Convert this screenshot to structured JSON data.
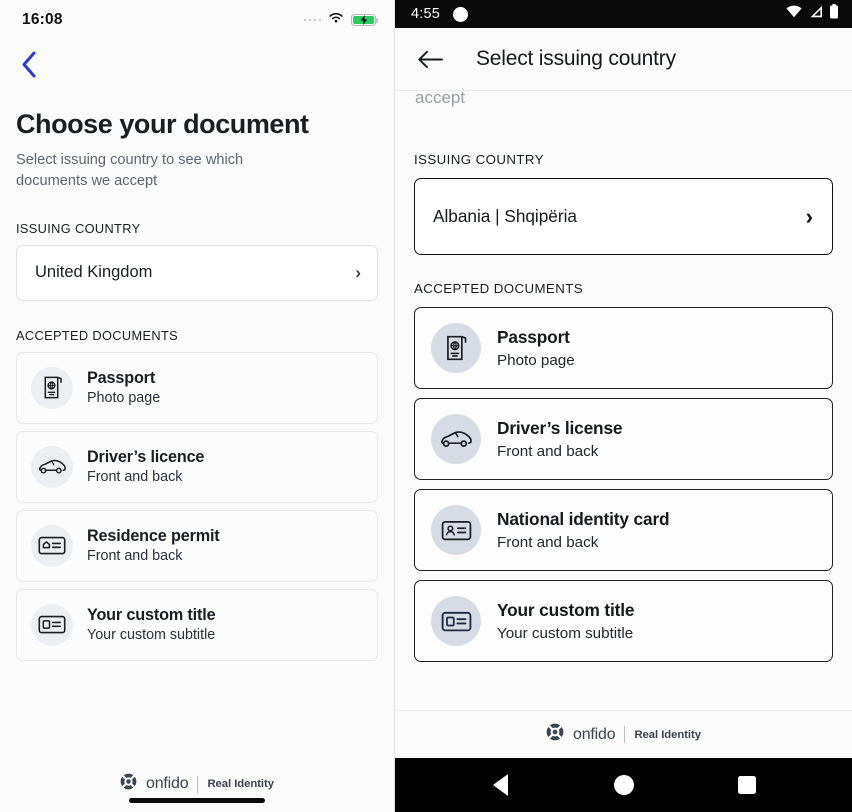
{
  "ios": {
    "status_bar": {
      "time": "16:08",
      "wifi_icon": "wifi-icon",
      "battery_icon": "battery-charging-icon",
      "signal_icon": "signal-dots-icon"
    },
    "back_icon": "chevron-left-icon",
    "heading": "Choose your document",
    "subheading": "Select issuing country to see which documents we accept",
    "issuing_country_label": "ISSUING COUNTRY",
    "selected_country": "United Kingdom",
    "country_chevron": "chevron-right-icon",
    "accepted_documents_label": "ACCEPTED DOCUMENTS",
    "documents": [
      {
        "title": "Passport",
        "subtitle": "Photo page",
        "icon": "passport-icon"
      },
      {
        "title": "Driver’s licence",
        "subtitle": "Front and back",
        "icon": "car-icon"
      },
      {
        "title": "Residence permit",
        "subtitle": "Front and back",
        "icon": "residence-permit-icon"
      },
      {
        "title": "Your custom title",
        "subtitle": "Your custom subtitle",
        "icon": "id-card-icon"
      }
    ],
    "brand": {
      "name": "onfido",
      "tagline": "Real Identity",
      "logo_icon": "onfido-logo-icon"
    }
  },
  "android": {
    "status_bar": {
      "time": "4:55",
      "wifi_icon": "wifi-icon",
      "signal_icon": "cell-signal-icon",
      "battery_icon": "battery-icon",
      "camera_punch_hole": "camera-punchhole"
    },
    "app_bar": {
      "back_icon": "arrow-left-icon",
      "title": "Select issuing country"
    },
    "clipped_text": "accept",
    "issuing_country_label": "ISSUING COUNTRY",
    "selected_country": "Albania | Shqipëria",
    "country_chevron": "chevron-right-icon",
    "accepted_documents_label": "ACCEPTED DOCUMENTS",
    "documents": [
      {
        "title": "Passport",
        "subtitle": "Photo page",
        "icon": "passport-icon"
      },
      {
        "title": "Driver’s license",
        "subtitle": "Front and back",
        "icon": "car-icon"
      },
      {
        "title": "National identity card",
        "subtitle": "Front and back",
        "icon": "national-id-card-icon"
      },
      {
        "title": "Your custom title",
        "subtitle": "Your custom subtitle",
        "icon": "id-card-icon"
      }
    ],
    "brand": {
      "name": "onfido",
      "tagline": "Real Identity",
      "logo_icon": "onfido-logo-icon"
    },
    "nav_bar": {
      "back": "nav-back-icon",
      "home": "nav-home-icon",
      "recents": "nav-recents-icon"
    }
  },
  "colors": {
    "ios_accent": "#2B35E8",
    "text_primary": "#1a1d21",
    "text_secondary": "#5b6572",
    "ios_card_border": "#e6e8ea",
    "android_card_border": "#1f2125",
    "icon_bubble_ios": "#eceef2",
    "icon_bubble_android": "#d7dbe3",
    "battery_green": "#2ACC5B",
    "page_bg": "#fbfbfb"
  }
}
